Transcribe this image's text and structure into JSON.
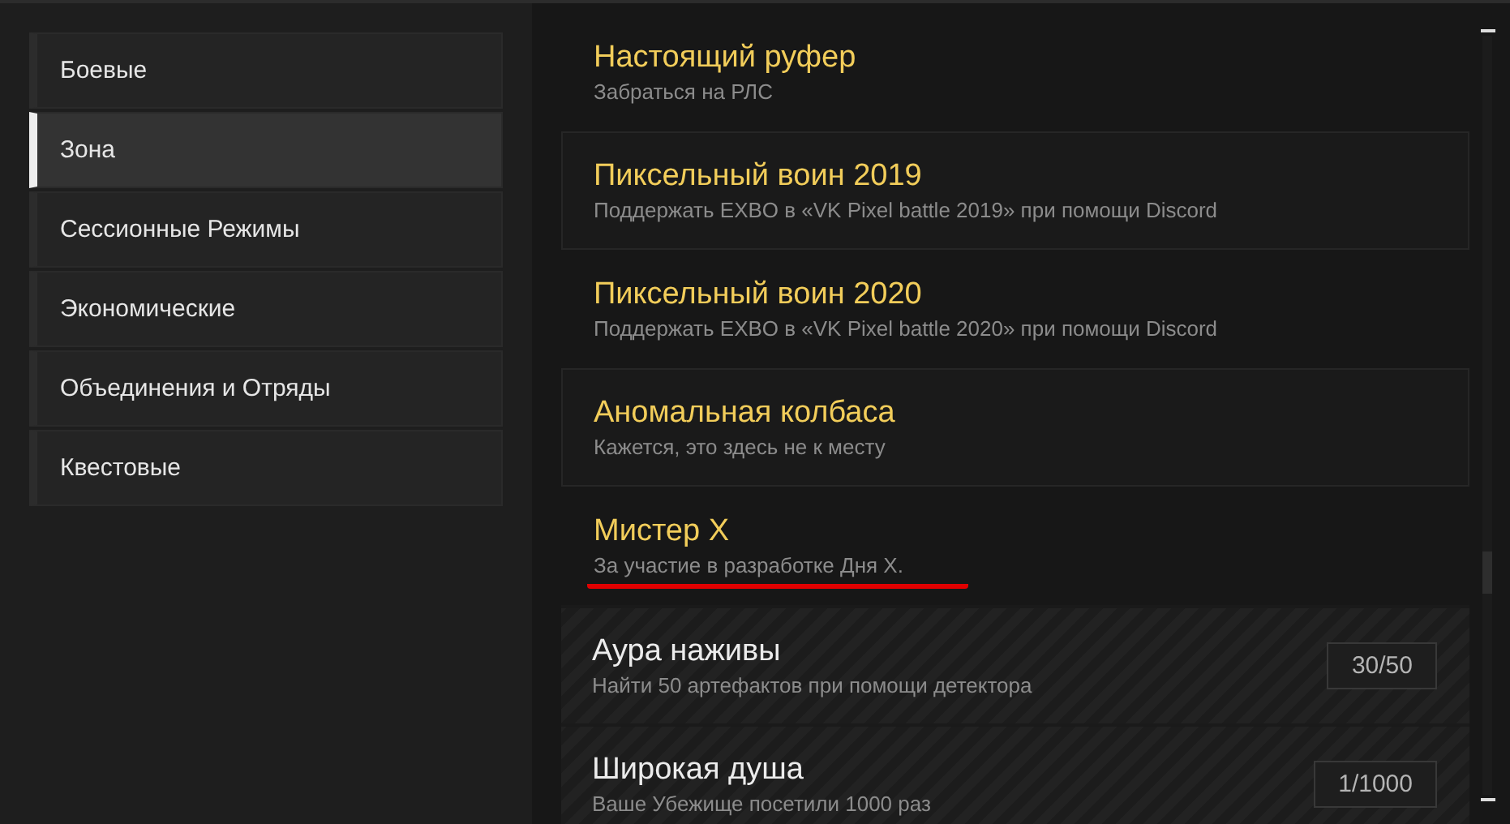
{
  "sidebar": {
    "items": [
      {
        "label": "Боевые",
        "selected": false
      },
      {
        "label": "Зона",
        "selected": true
      },
      {
        "label": "Сессионные Режимы",
        "selected": false
      },
      {
        "label": "Экономические",
        "selected": false
      },
      {
        "label": "Объединения и Отряды",
        "selected": false
      },
      {
        "label": "Квестовые",
        "selected": false
      }
    ]
  },
  "achievements": [
    {
      "title": "Настоящий руфер",
      "description": "Забраться на РЛС",
      "completed": true,
      "underlined": false
    },
    {
      "title": "Пиксельный воин 2019",
      "description": "Поддержать EXBO в «VK Pixel battle 2019» при помощи Discord",
      "completed": true,
      "underlined": false
    },
    {
      "title": "Пиксельный воин 2020",
      "description": "Поддержать EXBO в «VK Pixel battle 2020» при помощи Discord",
      "completed": true,
      "underlined": false
    },
    {
      "title": "Аномальная колбаса",
      "description": "Кажется, это здесь не к месту",
      "completed": true,
      "underlined": false
    },
    {
      "title": "Мистер X",
      "description": "За участие в разработке Дня Х.",
      "completed": true,
      "underlined": true
    },
    {
      "title": "Аура наживы",
      "description": "Найти 50 артефактов при помощи детектора",
      "completed": false,
      "progress": "30/50",
      "underlined": false
    },
    {
      "title": "Широкая душа",
      "description": "Ваше Убежище посетили 1000 раз",
      "completed": false,
      "progress": "1/1000",
      "underlined": false
    }
  ]
}
